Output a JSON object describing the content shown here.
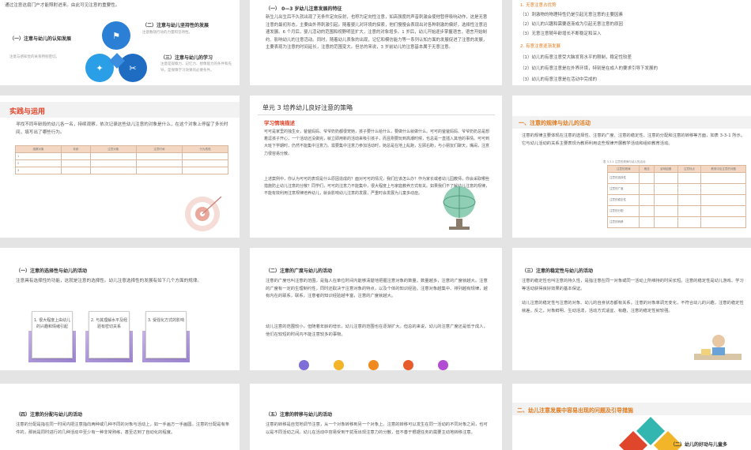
{
  "slide1": {
    "top_text": "通过注意这扇门户才能照射进来。由此可见注意的重要性。",
    "item1_title": "（一）注意与幼儿的认知发展",
    "item1_desc": "注意与感知觉的关系特别密切。",
    "item2_title": "（二）注意与幼儿坚持性的发展",
    "item2_desc": "注意数随行动的力量和坚持性。",
    "item3_title": "（三）注意与幼儿的学习",
    "item3_desc": "注意是观察力、记忆力、想像能力的条件和先导，是保障学习效果的必要条件。"
  },
  "slide2": {
    "title": "（一） 0—3 岁幼儿注意发展的特征",
    "para": "新生儿出生后不久就出现了无条件定向反射，也称为定向性注意，如高强度的声音刺激会使他暂停吸吮动作，这是无意注意的最初形态，主要由外界刺激引起。随着婴儿对环境的探索，他们慢慢会表现出对各种刺激的偏好，选择性注意迅速发展。6 个月后，婴儿活动的范围和视野明显扩大，注意的对象增多。1 岁后，幼儿开始逐步掌握语言，语言开始制约、影响幼儿的注意活动。同时，随着幼儿表象的出现，记忆和模仿能力等一系列认知方面的发展促进了注意的发展，主要表现为注意的时间延长，注意的范围变大。但总的来说，3 岁前幼儿的注意基本属于无意注意。"
  },
  "slide3": {
    "h1": "1. 无意注意占优势",
    "l1": "（1）刺激物的物理特性仍是引起无意注意的主要因素",
    "l2": "（2）幼儿的兴趣和需要逐渐成为引起无意注意的原因",
    "l3": "（3）无意注意随年龄增长不断稳定和深入",
    "h2": "2. 有意注意逐渐发展",
    "l4": "（1）幼儿的有意注意受大脑发育水平的限制，稳定性较差",
    "l5": "（2）幼儿的有意注意是在外界环境，特别是在成人的要求引导下发展的",
    "l6": "（3）幼儿的有意注意是在活动中完成的"
  },
  "slide4": {
    "title": "实践与运用",
    "para": "寻找不同年龄段的幼儿各一名，持续观察，依次记录这些幼儿注意的对象是什么，在这个对象上停留了多长时间，填写出了哪些行为。",
    "headers": [
      "观察对象",
      "年龄",
      "注意对象",
      "注意时间",
      "行为表现"
    ],
    "rows": [
      "1",
      "2",
      "3"
    ]
  },
  "slide5": {
    "unit": "单元 3 培养幼儿良好注意的策略",
    "section": "学习情境描述",
    "p1": "可可是家里的独生女，爸爸妈妈、爷爷奶奶都很宠她，孩子要什么给什么，要做什么就做什么。可可的爸爸妈妈、爷爷奶奶总是想着逗孩子开心，一个活动还没做完，就立即用新的活动来吸引孩子，而且刚要玩到高潮时候，也总是一直插入其他的事情。可可到大班下学期时，仍然不能集中注意力。需要集中注意力参加活动时，她总是在地上乱跑，左顾右盼，与小朋友们聊天，嘴闹，注意力很容易分散。",
    "p2": "上述案例中，你认为可可的表现是什么原因造成的？面对可可的情况，我们应该怎么办？作为家长或者幼儿园教师，你会采取哪些措施防止幼儿注意的分散？同学们，可可的注意力不能集中，很大程度上与家庭教养方式有关。如果我们不了解幼儿注意的规律，不能有效利用注意规律培养幼儿，就会影响幼儿注意的发展，严重时会发展为儿童多动症。"
  },
  "slide6": {
    "title": "一、注意的规律与幼儿的活动",
    "para": "注意的规律主要体现在注意的选择性、注意的广度、注意的稳定性、注意的分配和注意的转移等方面，如表 3-3-1 所示。它与幼儿活动的关系主要表现为教师利用这些规律开展教学活动和组织教育活动。",
    "caption": "表 3-3-1 注意的规律与幼儿的活动",
    "headers": [
      "注意的规律",
      "概念",
      "影响因素",
      "注意特点",
      "教育中应注意的问题"
    ],
    "rows": [
      "注意的选择性",
      "注意的广度",
      "注意的稳定性",
      "注意的分配",
      "注意的转移"
    ]
  },
  "slide7": {
    "title": "（一）注意的选择性与幼儿的活动",
    "para": "注意具有选择性的功能，这就是注意的选择性。幼儿注意选择性的发展有如下几个方面的规律。",
    "c1": "1. 很大程度上由幼儿的兴趣和情绪引起",
    "c2": "2. 与其理解水平及经验有密切关系",
    "c3": "3. 受强化方式的影响"
  },
  "slide8": {
    "title": "（二）注意的广度与幼儿的活动",
    "p1": "注意的广度也叫注意的范围，是指人在单位时间内能够清楚地把握注意对象的数量。数量越多，注意的广度就越大。注意的广度有一定的生理制约性，同时还取决于注意对象的特点，以及个体的知识经验。注意对象越集中、排列越有规律，越有内在的联系，联系，注意者的知识经验越丰富，注意的广度就越大。",
    "p2": "幼儿注意的范围较小，但随着年龄的增长，幼儿注意的范围也在逐渐扩大。但总的来说，幼儿的注意广度还是低于成人，他们在较短的时间内不能注意较多的事物。",
    "dot_colors": [
      "#7e6fd6",
      "#f2b428",
      "#f08a1e",
      "#e85c2c",
      "#b14cd3"
    ]
  },
  "slide9": {
    "title": "（三）注意的稳定性与幼儿的活动",
    "p1": "注意的稳定性也叫注意的持久性，是指注意在同一对象或同一活动上所维持的时间长短。注意的稳定性是幼儿游戏、学习等活动获得良好效果的基本保证。",
    "p2": "幼儿注意的稳定性与注意的对象、幼儿的自身状态都有关系。注意的对象单调无变化，不符合幼儿的兴趣，注意的稳定性就差。反之，对象鲜明、生动活泼，活动方式适宜、有趣，注意的稳定性就较强。"
  },
  "slide10": {
    "title": "（四）注意的分配与幼儿的活动",
    "para": "注意的分配是指在同一时间内把注意指向两种或几种不同的对象与活动上，如一手画方一手画圆。注意的分配是有条件的，那就是同时进行的几种活动中至少有一种非常熟练，甚至达到了自动化的程度。"
  },
  "slide11": {
    "title": "（五）注意的转移与幼儿的活动",
    "para": "注意的转移是自觉地调节注意，从一个对象转移到另一个对象上。注意的转移可以发生在同一活动的不同对象之间，也可以是不同活动之间。幼儿在活动中容易受到干扰而出现注意力的分散，但不善于根据任务的需要主动地转移注意。"
  },
  "slide12": {
    "title": "二、幼儿注意发展中容易出现的问题及引导措施",
    "sub": "（二）幼儿的好动与儿童多"
  }
}
